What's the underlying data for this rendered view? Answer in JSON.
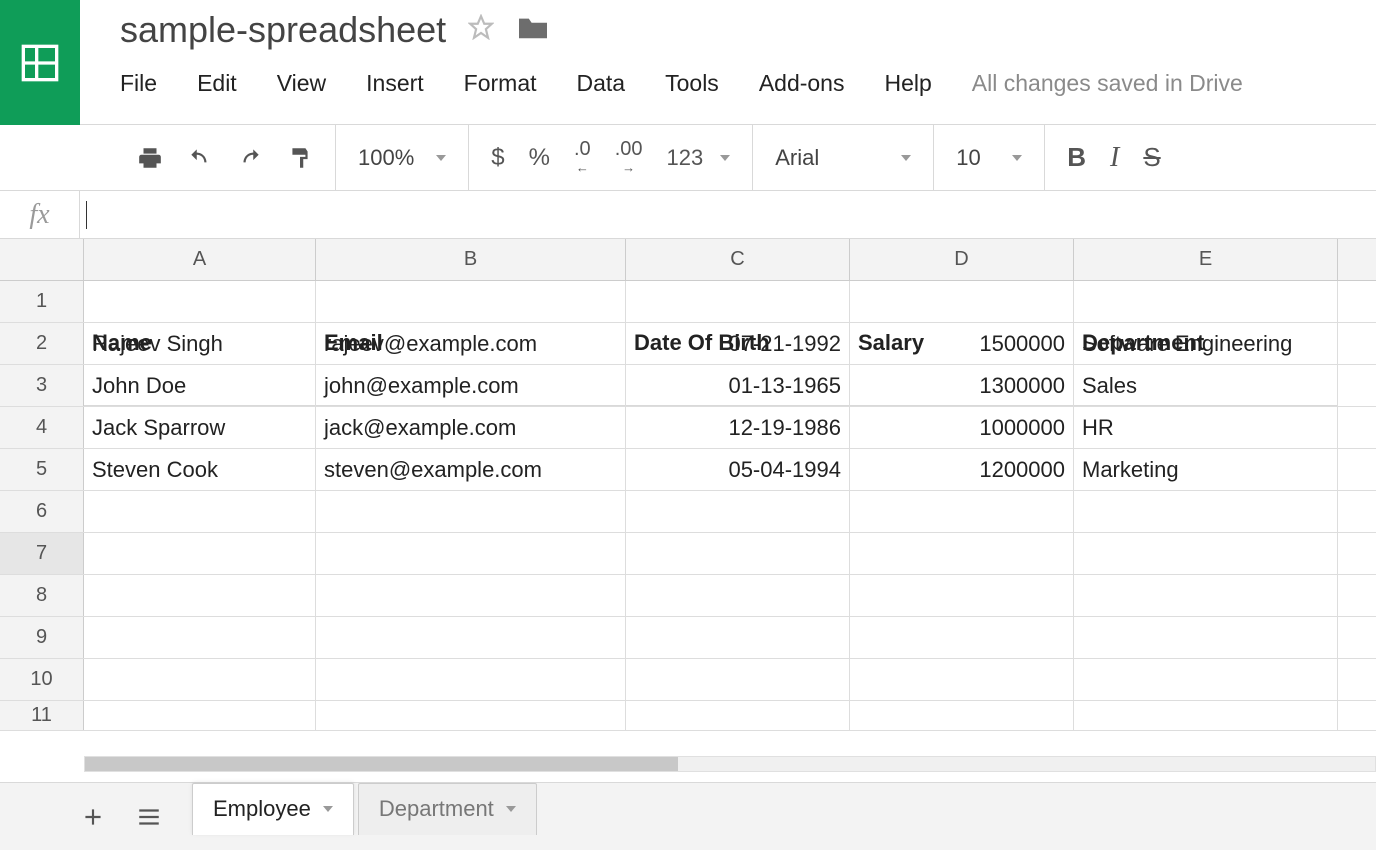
{
  "header": {
    "title": "sample-spreadsheet",
    "menus": [
      "File",
      "Edit",
      "View",
      "Insert",
      "Format",
      "Data",
      "Tools",
      "Add-ons",
      "Help"
    ],
    "status": "All changes saved in Drive"
  },
  "toolbar": {
    "zoom": "100%",
    "currency": "$",
    "percent": "%",
    "dec_minus": ".0",
    "dec_plus": ".00",
    "num_fmt": "123",
    "font_name": "Arial",
    "font_size": "10",
    "bold": "B",
    "italic": "I",
    "strike": "S"
  },
  "formula_bar": {
    "label": "fx",
    "value": ""
  },
  "grid": {
    "columns": [
      "A",
      "B",
      "C",
      "D",
      "E"
    ],
    "headers": [
      "Name",
      "Email",
      "Date Of Birth",
      "Salary",
      "Department"
    ],
    "rows": [
      {
        "n": "1",
        "name": "Rajeev Singh",
        "email": "rajeev@example.com",
        "dob": "07-21-1992",
        "salary": "1500000",
        "dept": "Software Engineering"
      },
      {
        "n": "2",
        "name": "John Doe",
        "email": "john@example.com",
        "dob": "01-13-1965",
        "salary": "1300000",
        "dept": "Sales"
      },
      {
        "n": "3",
        "name": "Jack Sparrow",
        "email": "jack@example.com",
        "dob": "12-19-1986",
        "salary": "1000000",
        "dept": "HR"
      },
      {
        "n": "4",
        "name": "Steven Cook",
        "email": "steven@example.com",
        "dob": "05-04-1994",
        "salary": "1200000",
        "dept": "Marketing"
      }
    ],
    "empty_rows": [
      "6",
      "7",
      "8",
      "9",
      "10",
      "11"
    ],
    "selected_row": "7"
  },
  "sheets": {
    "tabs": [
      {
        "name": "Employee",
        "active": true
      },
      {
        "name": "Department",
        "active": false
      }
    ]
  }
}
